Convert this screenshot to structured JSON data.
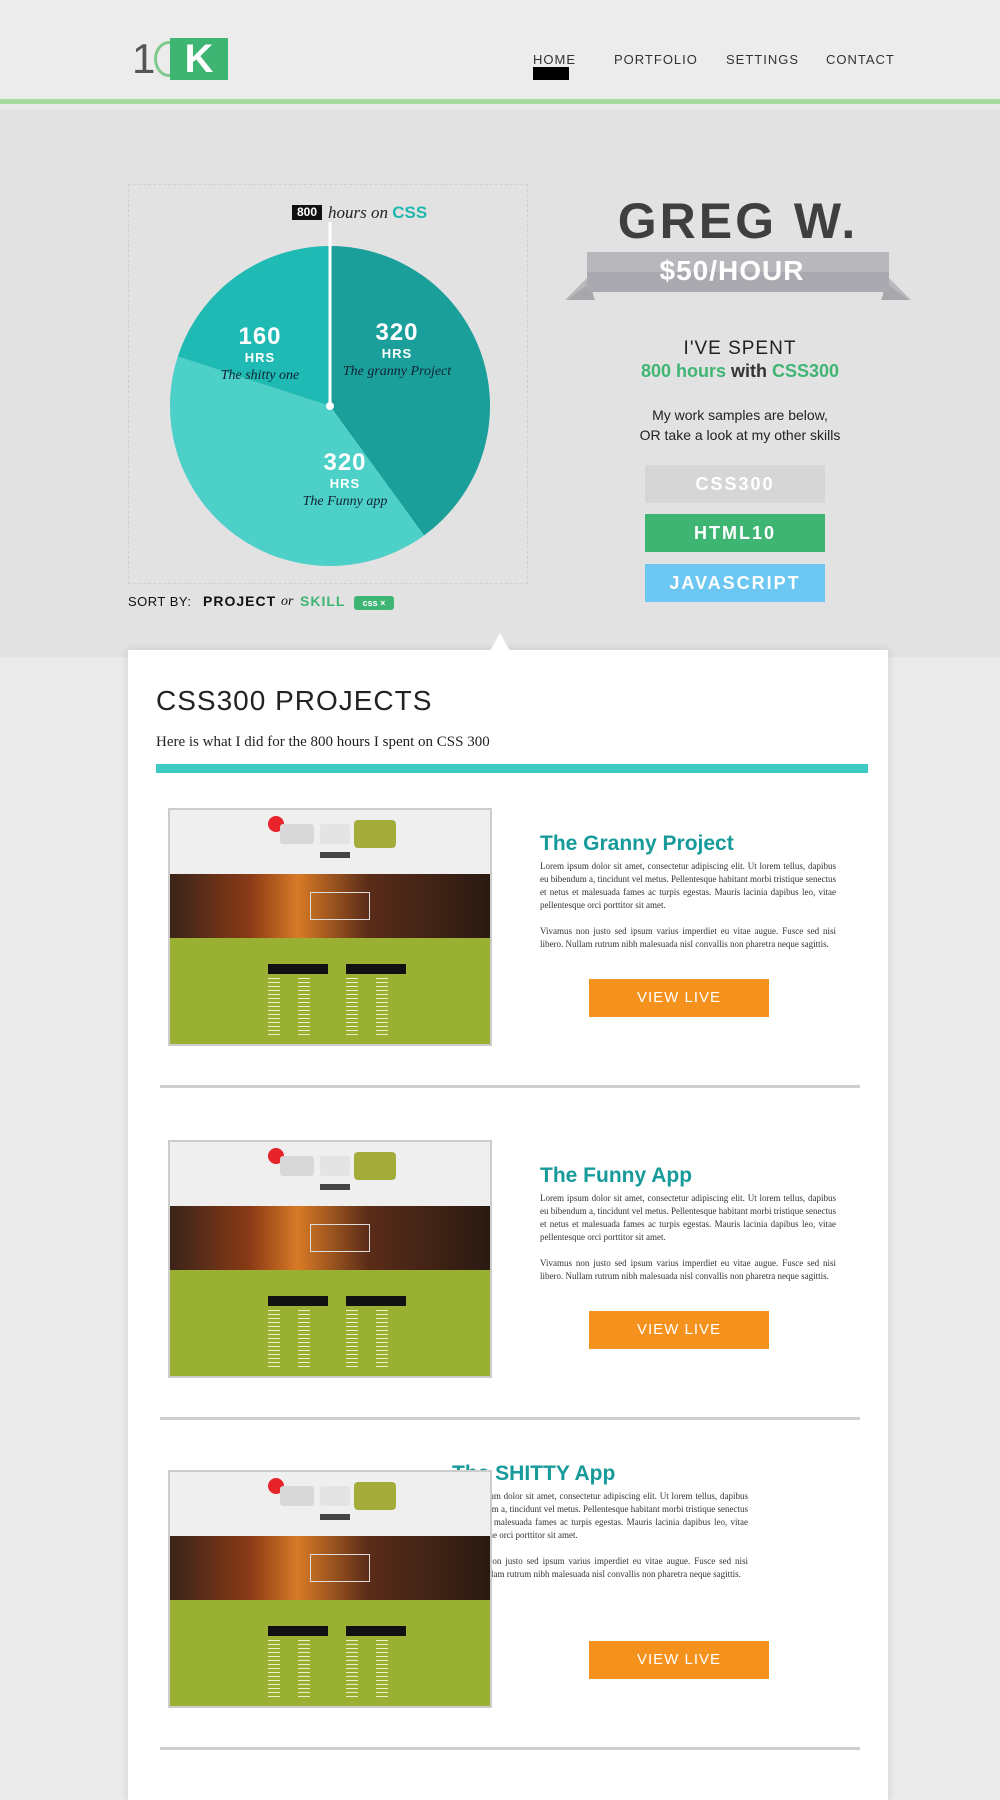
{
  "header": {
    "logo": {
      "one": "1",
      "k": "K"
    },
    "nav": [
      "HOME",
      "PORTFOLIO",
      "SETTINGS",
      "CONTACT"
    ],
    "active": "HOME"
  },
  "hero": {
    "pie": {
      "total_hours": "800",
      "title_mid": "hours on",
      "skill": "CSS",
      "slices": [
        {
          "hours": "320",
          "unit": "HRS",
          "name": "The granny Project",
          "value": 320,
          "color": "#1a9f9b"
        },
        {
          "hours": "320",
          "unit": "HRS",
          "name": "The Funny app",
          "value": 320,
          "color": "#4cd0c8"
        },
        {
          "hours": "160",
          "unit": "HRS",
          "name": "The shitty one",
          "value": 160,
          "color": "#1fbab3"
        }
      ]
    },
    "sort": {
      "label": "SORT BY:",
      "project": "PROJECT",
      "or": "or",
      "skill": "SKILL",
      "chip": "css ×"
    },
    "person": {
      "name": "GREG W.",
      "rate": "$50/HOUR"
    },
    "spent": {
      "line1": "I'VE SPENT",
      "hours": "800 hours",
      "with": "with",
      "skill": "CSS300"
    },
    "samples": {
      "line1": "My work samples are below,",
      "line2": "OR take a look at my other skills"
    },
    "skills": [
      {
        "label": "CSS300",
        "color": "#d6d6d6"
      },
      {
        "label": "HTML10",
        "color": "#3fb573"
      },
      {
        "label": "JAVASCRIPT",
        "color": "#6cc8f2"
      }
    ]
  },
  "projects_section": {
    "title": "CSS300 PROJECTS",
    "subtitle": "Here is what I did for the 800 hours I spent on CSS 300",
    "items": [
      {
        "title": "The Granny Project",
        "para1": "Lorem ipsum dolor sit amet, consectetur adipiscing elit. Ut lorem tellus, dapibus eu bibendum a, tincidunt vel metus. Pellentesque habitant morbi tristique senectus et netus et malesuada fames ac turpis egestas. Mauris lacinia dapibus leo, vitae pellentesque orci porttitor sit amet.",
        "para2": "Vivamus non justo sed ipsum varius imperdiet eu vitae augue. Fusce sed nisi libero. Nullam rutrum nibh malesuada nisl convallis non pharetra neque sagittis.",
        "button": "VIEW LIVE"
      },
      {
        "title": "The Funny App",
        "para1": "Lorem ipsum dolor sit amet, consectetur adipiscing elit. Ut lorem tellus, dapibus eu bibendum a, tincidunt vel metus. Pellentesque habitant morbi tristique senectus et netus et malesuada fames ac turpis egestas. Mauris lacinia dapibus leo, vitae pellentesque orci porttitor sit amet.",
        "para2": "Vivamus non justo sed ipsum varius imperdiet eu vitae augue. Fusce sed nisi libero. Nullam rutrum nibh malesuada nisl convallis non pharetra neque sagittis.",
        "button": "VIEW LIVE"
      },
      {
        "title": "The SHITTY App",
        "para1": "Lorem ipsum dolor sit amet, consectetur adipiscing elit. Ut lorem tellus, dapibus eu bibendum a, tincidunt vel metus. Pellentesque habitant morbi tristique senectus et netus et malesuada fames ac turpis egestas. Mauris lacinia dapibus leo, vitae pellentesque orci porttitor sit amet.",
        "para2": "Vivamus non justo sed ipsum varius imperdiet eu vitae augue. Fusce sed nisi libero. Nullam rutrum nibh malesuada nisl convallis non pharetra neque sagittis.",
        "button": "VIEW LIVE"
      }
    ]
  },
  "colors": {
    "accent_green": "#3fb573",
    "teal": "#1fb8ae",
    "orange": "#f5921e",
    "header_rule": "#a6d99e"
  }
}
